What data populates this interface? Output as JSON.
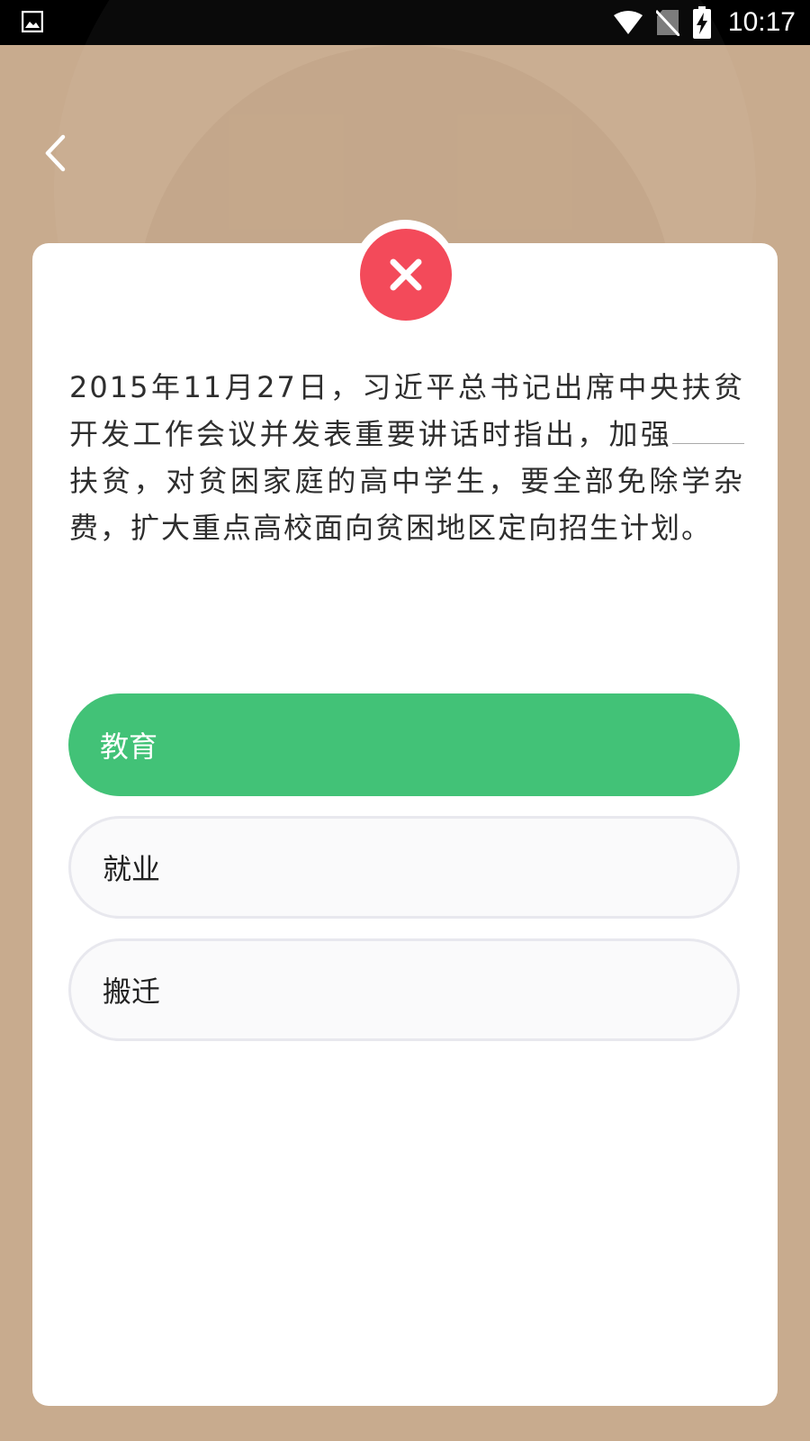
{
  "status_bar": {
    "time": "10:17",
    "icons": [
      "gallery-icon",
      "wifi-icon",
      "no-sim-icon",
      "battery-charging-icon"
    ]
  },
  "nav": {
    "back_icon": "chevron-left-icon"
  },
  "result": {
    "icon": "close-icon",
    "color": "#f34a5a"
  },
  "question": {
    "text_before": "2015年11月27日，习近平总书记出席中央扶贫开发工作会议并发表重要讲话时指出，加强",
    "text_after": "扶贫，对贫困家庭的高中学生，要全部免除学杂费，扩大重点高校面向贫困地区定向招生计划。"
  },
  "options": [
    {
      "label": "教育",
      "state": "correct"
    },
    {
      "label": "就业",
      "state": "normal"
    },
    {
      "label": "搬迁",
      "state": "normal"
    }
  ],
  "colors": {
    "background": "#c8ab8e",
    "correct": "#42c277",
    "wrong": "#f34a5a",
    "option_border": "#e8e8ee"
  }
}
